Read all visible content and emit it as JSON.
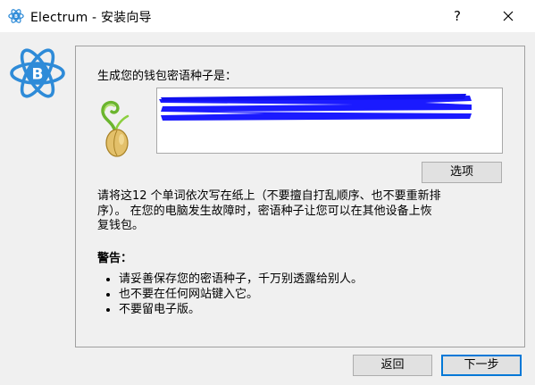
{
  "window": {
    "title": "Electrum  -  安装向导",
    "help_label": "?",
    "close_icon": "close-icon",
    "app_icon": "electrum-logo-icon"
  },
  "content": {
    "prompt": "生成您的钱包密语种子是：",
    "seed_text": "",
    "seed_redacted": true,
    "redaction_color": "#1a1aff",
    "options_label": "选项",
    "instructions_line1": "请将这12 个单词依次写在纸上（不要擅自打乱顺序、也不要重新排",
    "instructions_line2": "序）。 在您的电脑发生故障时，密语种子让您可以在其他设备上恢",
    "instructions_line3": "复钱包。",
    "warning_title": "警告：",
    "warnings": [
      "请妥善保存您的密语种子，千万别透露给别人。",
      "也不要在任何网站键入它。",
      "不要留电子版。"
    ]
  },
  "footer": {
    "back_label": "返回",
    "next_label": "下一步"
  },
  "colors": {
    "accent": "#0078d7",
    "logo_blue": "#2e8bd8"
  }
}
